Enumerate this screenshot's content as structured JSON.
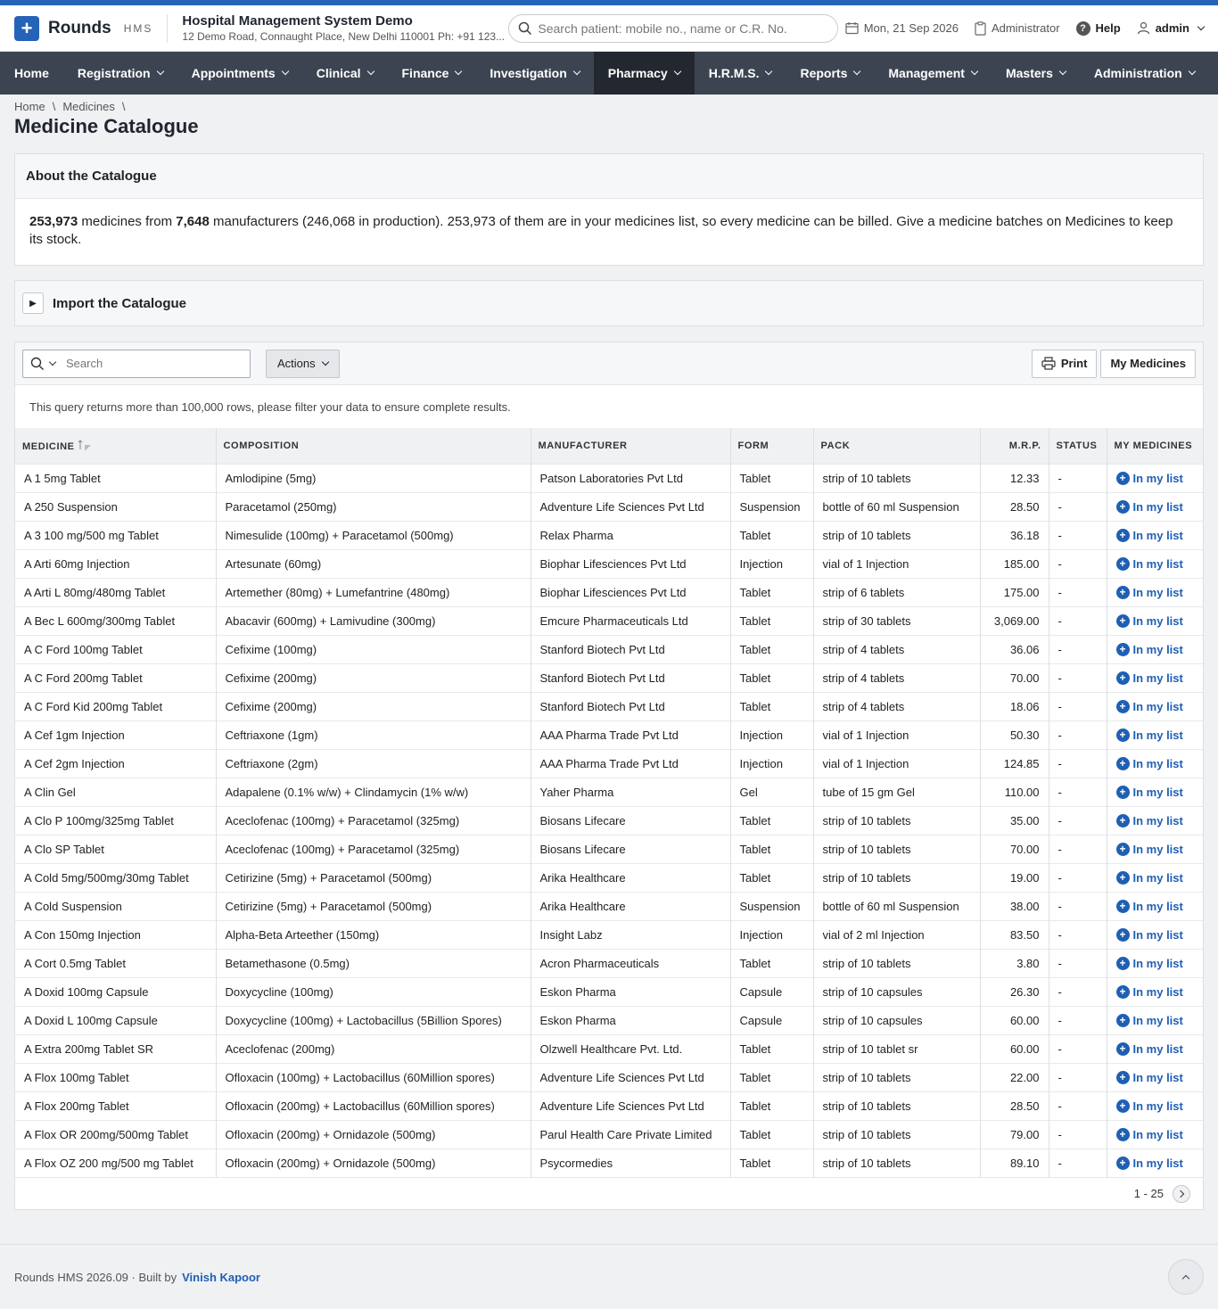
{
  "app": {
    "name": "Rounds",
    "sub": "HMS"
  },
  "org": {
    "name": "Hospital Management System Demo",
    "address": "12 Demo Road, Connaught Place, New Delhi 110001 Ph: +91 123..."
  },
  "header": {
    "search_placeholder": "Search patient: mobile no., name or C.R. No.",
    "date": "Mon, 21 Sep 2026",
    "role": "Administrator",
    "help": "Help",
    "user": "admin"
  },
  "nav": [
    {
      "label": "Home",
      "dropdown": false
    },
    {
      "label": "Registration",
      "dropdown": true
    },
    {
      "label": "Appointments",
      "dropdown": true
    },
    {
      "label": "Clinical",
      "dropdown": true
    },
    {
      "label": "Finance",
      "dropdown": true
    },
    {
      "label": "Investigation",
      "dropdown": true
    },
    {
      "label": "Pharmacy",
      "dropdown": true,
      "active": true
    },
    {
      "label": "H.R.M.S.",
      "dropdown": true
    },
    {
      "label": "Reports",
      "dropdown": true
    },
    {
      "label": "Management",
      "dropdown": true
    },
    {
      "label": "Masters",
      "dropdown": true
    },
    {
      "label": "Administration",
      "dropdown": true
    }
  ],
  "breadcrumb": [
    "Home",
    "Medicines"
  ],
  "page_title": "Medicine Catalogue",
  "about": {
    "heading": "About the Catalogue",
    "medicines": "253,973",
    "text1": " medicines from ",
    "manufacturers": "7,648",
    "text2": " manufacturers (246,068 in production). 253,973 of them are in your medicines list, so every medicine can be billed. Give a medicine batches on Medicines to keep its stock."
  },
  "import": {
    "heading": "Import the Catalogue"
  },
  "toolbar": {
    "search_placeholder": "Search",
    "actions": "Actions",
    "print": "Print",
    "my_medicines": "My Medicines"
  },
  "notice": "This query returns more than 100,000 rows, please filter your data to ensure complete results.",
  "columns": [
    "MEDICINE",
    "COMPOSITION",
    "MANUFACTURER",
    "FORM",
    "PACK",
    "M.R.P.",
    "STATUS",
    "MY MEDICINES"
  ],
  "in_list_label": "In my list",
  "rows": [
    [
      "A 1 5mg Tablet",
      "Amlodipine (5mg)",
      "Patson Laboratories Pvt Ltd",
      "Tablet",
      "strip of 10 tablets",
      "12.33",
      "-"
    ],
    [
      "A 250 Suspension",
      "Paracetamol (250mg)",
      "Adventure Life Sciences Pvt Ltd",
      "Suspension",
      "bottle of 60 ml Suspension",
      "28.50",
      "-"
    ],
    [
      "A 3 100 mg/500 mg Tablet",
      "Nimesulide (100mg) + Paracetamol (500mg)",
      "Relax Pharma",
      "Tablet",
      "strip of 10 tablets",
      "36.18",
      "-"
    ],
    [
      "A Arti 60mg Injection",
      "Artesunate (60mg)",
      "Biophar Lifesciences Pvt Ltd",
      "Injection",
      "vial of 1 Injection",
      "185.00",
      "-"
    ],
    [
      "A Arti L 80mg/480mg Tablet",
      "Artemether (80mg) + Lumefantrine (480mg)",
      "Biophar Lifesciences Pvt Ltd",
      "Tablet",
      "strip of 6 tablets",
      "175.00",
      "-"
    ],
    [
      "A Bec L 600mg/300mg Tablet",
      "Abacavir (600mg) + Lamivudine (300mg)",
      "Emcure Pharmaceuticals Ltd",
      "Tablet",
      "strip of 30 tablets",
      "3,069.00",
      "-"
    ],
    [
      "A C Ford 100mg Tablet",
      "Cefixime (100mg)",
      "Stanford Biotech Pvt Ltd",
      "Tablet",
      "strip of 4 tablets",
      "36.06",
      "-"
    ],
    [
      "A C Ford 200mg Tablet",
      "Cefixime (200mg)",
      "Stanford Biotech Pvt Ltd",
      "Tablet",
      "strip of 4 tablets",
      "70.00",
      "-"
    ],
    [
      "A C Ford Kid 200mg Tablet",
      "Cefixime (200mg)",
      "Stanford Biotech Pvt Ltd",
      "Tablet",
      "strip of 4 tablets",
      "18.06",
      "-"
    ],
    [
      "A Cef 1gm Injection",
      "Ceftriaxone (1gm)",
      "AAA Pharma Trade Pvt Ltd",
      "Injection",
      "vial of 1 Injection",
      "50.30",
      "-"
    ],
    [
      "A Cef 2gm Injection",
      "Ceftriaxone (2gm)",
      "AAA Pharma Trade Pvt Ltd",
      "Injection",
      "vial of 1 Injection",
      "124.85",
      "-"
    ],
    [
      "A Clin Gel",
      "Adapalene (0.1% w/w) + Clindamycin (1% w/w)",
      "Yaher Pharma",
      "Gel",
      "tube of 15 gm Gel",
      "110.00",
      "-"
    ],
    [
      "A Clo P 100mg/325mg Tablet",
      "Aceclofenac (100mg) + Paracetamol (325mg)",
      "Biosans Lifecare",
      "Tablet",
      "strip of 10 tablets",
      "35.00",
      "-"
    ],
    [
      "A Clo SP Tablet",
      "Aceclofenac (100mg) + Paracetamol (325mg)",
      "Biosans Lifecare",
      "Tablet",
      "strip of 10 tablets",
      "70.00",
      "-"
    ],
    [
      "A Cold 5mg/500mg/30mg Tablet",
      "Cetirizine (5mg) + Paracetamol (500mg)",
      "Arika Healthcare",
      "Tablet",
      "strip of 10 tablets",
      "19.00",
      "-"
    ],
    [
      "A Cold Suspension",
      "Cetirizine (5mg) + Paracetamol (500mg)",
      "Arika Healthcare",
      "Suspension",
      "bottle of 60 ml Suspension",
      "38.00",
      "-"
    ],
    [
      "A Con 150mg Injection",
      "Alpha-Beta Arteether (150mg)",
      "Insight Labz",
      "Injection",
      "vial of 2 ml Injection",
      "83.50",
      "-"
    ],
    [
      "A Cort 0.5mg Tablet",
      "Betamethasone (0.5mg)",
      "Acron Pharmaceuticals",
      "Tablet",
      "strip of 10 tablets",
      "3.80",
      "-"
    ],
    [
      "A Doxid 100mg Capsule",
      "Doxycycline (100mg)",
      "Eskon Pharma",
      "Capsule",
      "strip of 10 capsules",
      "26.30",
      "-"
    ],
    [
      "A Doxid L 100mg Capsule",
      "Doxycycline (100mg) + Lactobacillus (5Billion Spores)",
      "Eskon Pharma",
      "Capsule",
      "strip of 10 capsules",
      "60.00",
      "-"
    ],
    [
      "A Extra 200mg Tablet SR",
      "Aceclofenac (200mg)",
      "Olzwell Healthcare Pvt. Ltd.",
      "Tablet",
      "strip of 10 tablet sr",
      "60.00",
      "-"
    ],
    [
      "A Flox 100mg Tablet",
      "Ofloxacin (100mg) + Lactobacillus (60Million spores)",
      "Adventure Life Sciences Pvt Ltd",
      "Tablet",
      "strip of 10 tablets",
      "22.00",
      "-"
    ],
    [
      "A Flox 200mg Tablet",
      "Ofloxacin (200mg) + Lactobacillus (60Million spores)",
      "Adventure Life Sciences Pvt Ltd",
      "Tablet",
      "strip of 10 tablets",
      "28.50",
      "-"
    ],
    [
      "A Flox OR 200mg/500mg Tablet",
      "Ofloxacin (200mg) + Ornidazole (500mg)",
      "Parul Health Care Private Limited",
      "Tablet",
      "strip of 10 tablets",
      "79.00",
      "-"
    ],
    [
      "A Flox OZ 200 mg/500 mg Tablet",
      "Ofloxacin (200mg) + Ornidazole (500mg)",
      "Psycormedies",
      "Tablet",
      "strip of 10 tablets",
      "89.10",
      "-"
    ]
  ],
  "pager": "1 - 25",
  "footer": {
    "text": "Rounds HMS 2026.09 · Built by ",
    "author": "Vinish Kapoor"
  },
  "colors": {
    "brand": "#2563b8",
    "nav": "#3d4451",
    "nav_active": "#23272f",
    "link": "#1f5fb4"
  }
}
